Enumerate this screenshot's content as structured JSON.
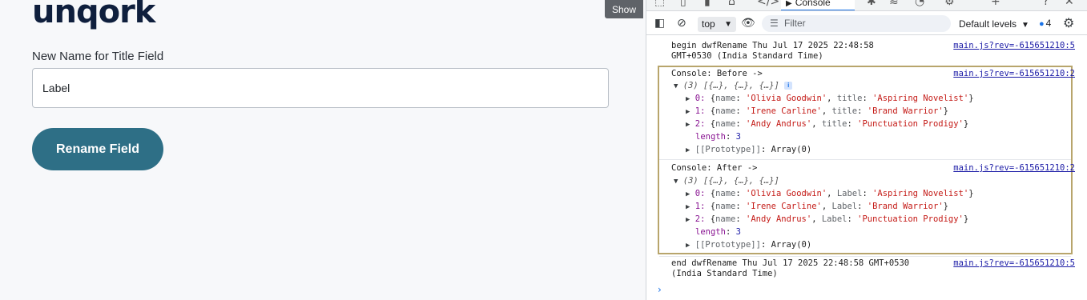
{
  "app": {
    "logo": "unqork",
    "field_label": "New Name for Title Field",
    "input_value": "Label",
    "button_label": "Rename Field",
    "show_label": "Show"
  },
  "devtools": {
    "console_tab": "Console",
    "context": "top",
    "filter_placeholder": "Filter",
    "levels": "Default levels",
    "issue_count": "4",
    "messages": {
      "begin_line1": "begin dwfRename Thu Jul 17 2025 22:48:58",
      "begin_line2": "GMT+0530 (India Standard Time)",
      "begin_src": "main.js?rev=-615651210:5",
      "before_label": "Console: Before ->",
      "before_src": "main.js?rev=-615651210:2",
      "after_label": "Console: After ->",
      "after_src": "main.js?rev=-615651210:2",
      "array_summary": "(3) [{…}, {…}, {…}]",
      "before_items": [
        {
          "idx": "0:",
          "name": "'Olivia Goodwin'",
          "key": "title",
          "val": "'Aspiring Novelist'"
        },
        {
          "idx": "1:",
          "name": "'Irene Carline'",
          "key": "title",
          "val": "'Brand Warrior'"
        },
        {
          "idx": "2:",
          "name": "'Andy Andrus'",
          "key": "title",
          "val": "'Punctuation Prodigy'"
        }
      ],
      "after_items": [
        {
          "idx": "0:",
          "name": "'Olivia Goodwin'",
          "key": "Label",
          "val": "'Aspiring Novelist'"
        },
        {
          "idx": "1:",
          "name": "'Irene Carline'",
          "key": "Label",
          "val": "'Brand Warrior'"
        },
        {
          "idx": "2:",
          "name": "'Andy Andrus'",
          "key": "Label",
          "val": "'Punctuation Prodigy'"
        }
      ],
      "length_key": "length",
      "length_val": "3",
      "prototype_key": "[[Prototype]]",
      "prototype_val": "Array(0)",
      "end_line1": "end dwfRename Thu Jul 17 2025 22:48:58 GMT+0530",
      "end_line2": "(India Standard Time)",
      "end_src": "main.js?rev=-615651210:5"
    }
  }
}
